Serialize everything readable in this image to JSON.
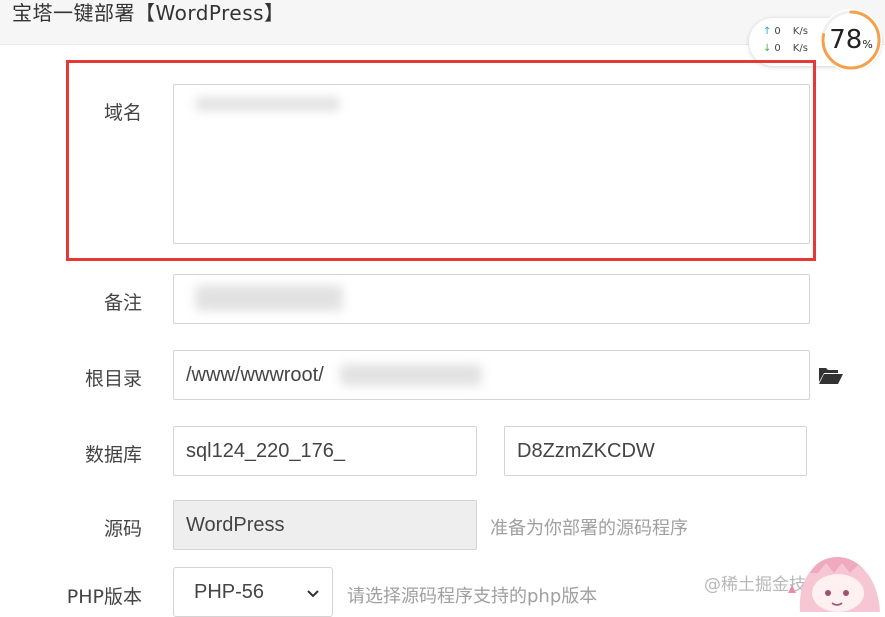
{
  "window": {
    "title": "宝塔一键部署【WordPress】"
  },
  "network": {
    "up_value": "0",
    "down_value": "0",
    "unit": "K/s"
  },
  "gauge": {
    "value": "78",
    "suffix": "%",
    "fraction": 0.78
  },
  "form": {
    "domain": {
      "label": "域名",
      "value": ""
    },
    "note": {
      "label": "备注",
      "value": ""
    },
    "root": {
      "label": "根目录",
      "value": "/www/wwwroot/",
      "browse_icon": "folder-open-icon"
    },
    "database": {
      "label": "数据库",
      "name_value": "sql124_220_176_",
      "password_value": "D8ZzmZKCDW"
    },
    "source": {
      "label": "源码",
      "value": "WordPress",
      "hint": "准备为你部署的源码程序"
    },
    "php": {
      "label": "PHP版本",
      "selected": "PHP-56",
      "hint": "请选择源码程序支持的php版本"
    }
  },
  "watermark": "@稀土掘金技术社区",
  "colors": {
    "highlight": "#e53935",
    "gauge": "#f5a04a"
  }
}
